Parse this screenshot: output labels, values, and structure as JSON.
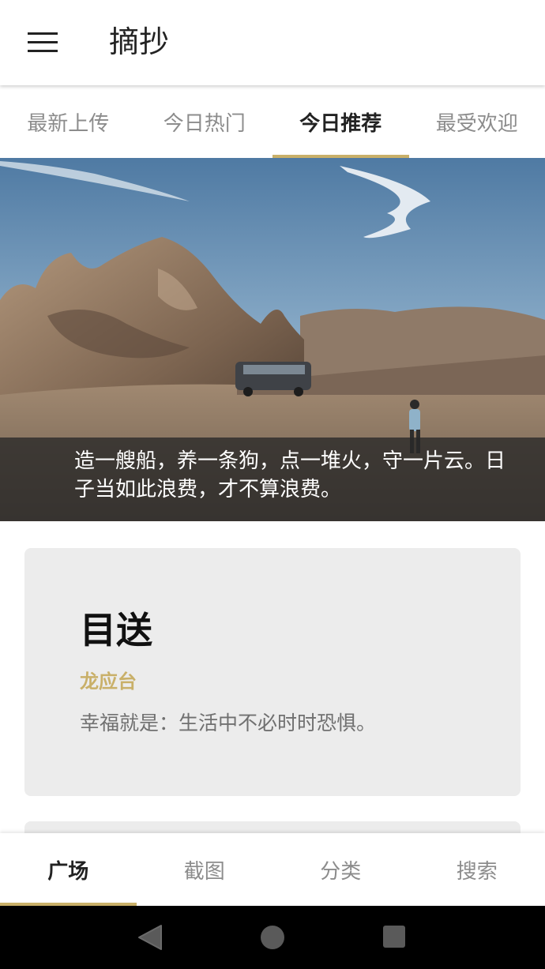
{
  "app": {
    "title": "摘抄",
    "accent_color": "#c9b069"
  },
  "header": {
    "menu_icon": "hamburger-menu-icon"
  },
  "tabs": [
    {
      "label": "最新上传",
      "active": false
    },
    {
      "label": "今日热门",
      "active": false
    },
    {
      "label": "今日推荐",
      "active": true
    },
    {
      "label": "最受欢迎",
      "active": false
    }
  ],
  "banner": {
    "caption": "造一艘船，养一条狗，点一堆火，守一片云。日子当如此浪费，才不算浪费。"
  },
  "card": {
    "title": "目送",
    "author": "龙应台",
    "quote": "幸福就是：生活中不必时时恐惧。"
  },
  "bottom_nav": [
    {
      "label": "广场",
      "active": true
    },
    {
      "label": "截图",
      "active": false
    },
    {
      "label": "分类",
      "active": false
    },
    {
      "label": "搜索",
      "active": false
    }
  ],
  "system_nav": {
    "back_icon": "back-triangle-icon",
    "home_icon": "home-circle-icon",
    "recent_icon": "recent-apps-square-icon"
  }
}
